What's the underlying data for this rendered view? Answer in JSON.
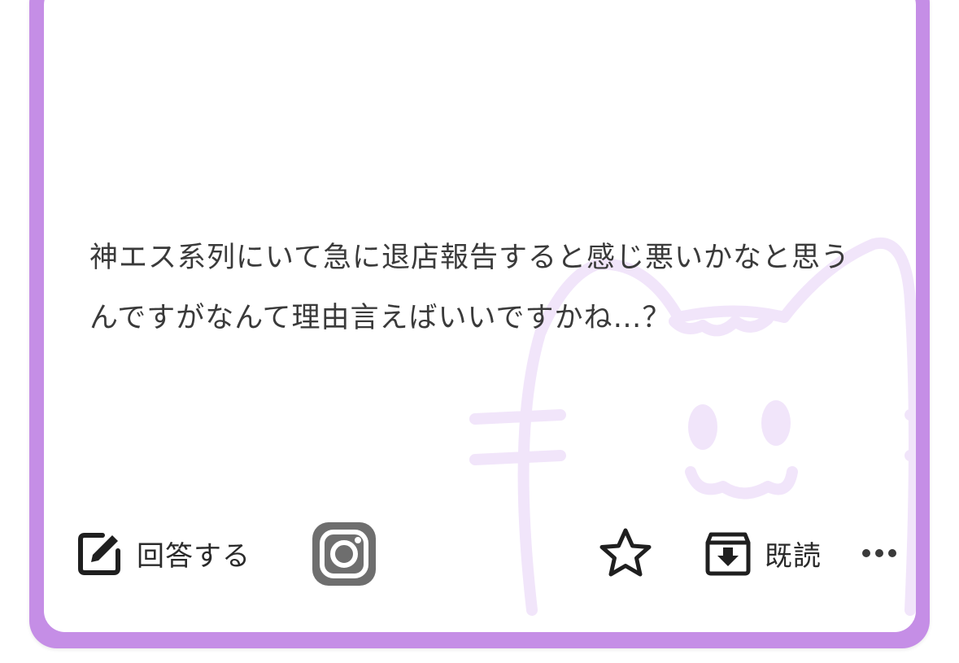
{
  "question": {
    "text": "神エス系列にいて急に退店報告すると感じ悪いかなと思うんですがなんて理由言えばいいですかね…？"
  },
  "actions": {
    "answer_label": "回答する",
    "read_label": "既読"
  },
  "icons": {
    "answer": "edit-icon",
    "instagram": "instagram-icon",
    "star": "star-icon",
    "archive": "archive-download-icon",
    "more": "more-dots-icon",
    "watermark": "cat-face-watermark"
  },
  "colors": {
    "frame": "#c58ee6",
    "card_background": "#ffffff",
    "text": "#3a3a3a",
    "icon": "#1f1f1f",
    "instagram_icon": "#6e6e6e",
    "watermark": "#f1e5fa"
  }
}
